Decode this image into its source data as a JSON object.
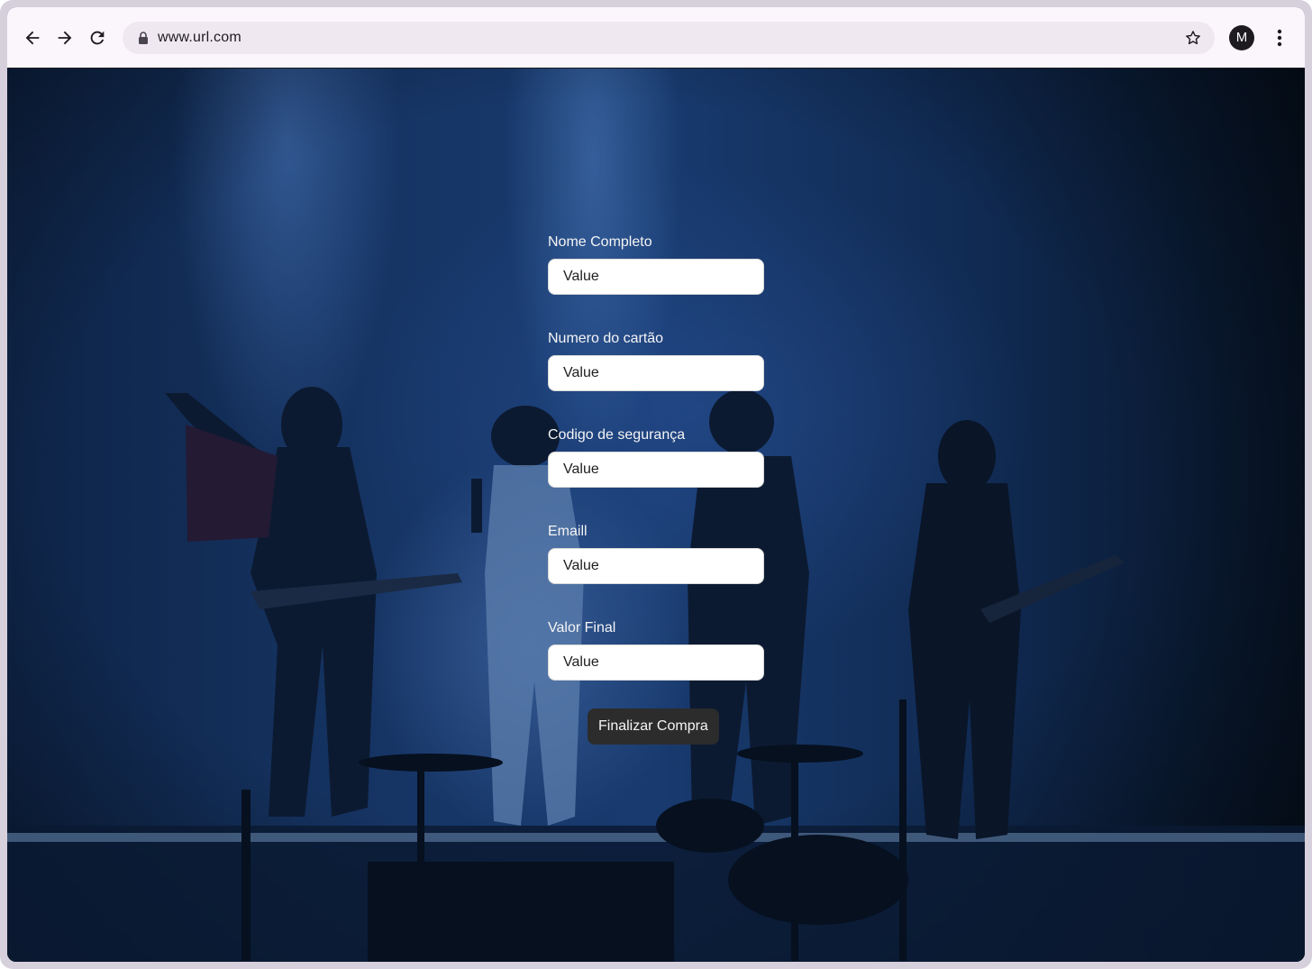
{
  "browser": {
    "url": "www.url.com",
    "avatar_initial": "M",
    "icons": {
      "back": "arrow-left-icon",
      "forward": "arrow-right-icon",
      "reload": "reload-icon",
      "lock": "lock-icon",
      "bookmark": "star-icon",
      "menu": "more-vertical-icon"
    }
  },
  "form": {
    "fields": [
      {
        "label": "Nome Completo",
        "value": "Value"
      },
      {
        "label": "Numero do cartão",
        "value": "Value"
      },
      {
        "label": "Codigo de segurança",
        "value": "Value"
      },
      {
        "label": "Emaill",
        "value": "Value"
      },
      {
        "label": "Valor Final",
        "value": "Value"
      }
    ],
    "submit_label": "Finalizar Compra"
  },
  "colors": {
    "toolbar_bg": "#fbf6fc",
    "omnibox_bg": "#efe8f0",
    "input_bg": "#ffffff",
    "button_bg": "#2c2c2c",
    "label_text": "#f5f5f5"
  }
}
